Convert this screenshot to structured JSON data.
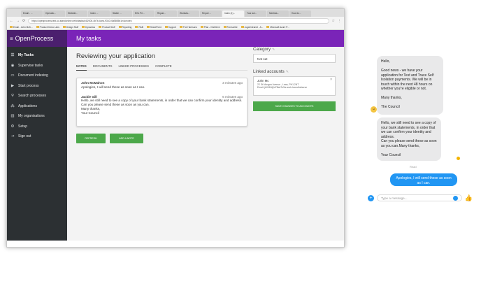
{
  "browser": {
    "tabs": [
      "Email - ...",
      "Operatio...",
      "Website...",
      "Index ...",
      "Stable ...",
      "EGL Pri...",
      "Repair...",
      "Worksta...",
      "Report ...",
      "Index (1)...",
      "Your act...",
      "Meetsta...",
      "How do..."
    ],
    "url": "https://openprocess.test.uo.standonline.net/#/tasks/d4f2000-4b7b-4cea-9310-f4a5805b1e4c/notes",
    "bookmarks": [
      "Email - John McK...",
      "Product Demo Labs",
      "Design Stuff",
      "Dynamics",
      "Product Stuff",
      "Reporting",
      "RAB",
      "SharePoint",
      "Support",
      "The Harrisons",
      "Plan - OneDrive",
      "Forescribe",
      "Jugal Intranet - A...",
      "Microsoft Azure P..."
    ]
  },
  "app": {
    "brand": "OpenProcess",
    "header_title": "My tasks"
  },
  "sidebar": {
    "items": [
      {
        "label": "My Tasks",
        "icon": "list-icon"
      },
      {
        "label": "Supervise tasks",
        "icon": "supervise-icon"
      },
      {
        "label": "Document indexing",
        "icon": "document-icon"
      },
      {
        "label": "Start process",
        "icon": "play-icon"
      },
      {
        "label": "Search processes",
        "icon": "search-icon"
      },
      {
        "label": "Applications",
        "icon": "applications-icon"
      },
      {
        "label": "My organisations",
        "icon": "organisation-icon"
      },
      {
        "label": "Setup",
        "icon": "gear-icon"
      },
      {
        "label": "Sign out",
        "icon": "sign-out-icon"
      }
    ]
  },
  "main": {
    "title": "Reviewing your application",
    "tabs": [
      "NOTES",
      "DOCUMENTS",
      "LINKED PROCESSES",
      "COMPLETE"
    ],
    "notes": [
      {
        "author": "John McMahon",
        "time": "3 minutes ago",
        "text": "Apologies, I will send these as soon as I can."
      },
      {
        "author": "Jackie Gill",
        "time": "6 minutes ago",
        "text": "Hello, we still need to see a copy of your bank statements, in order that we can confirm your identity and address.\nCan you please send these as soon as you can.\nMany thanks,\nYour Council"
      }
    ],
    "refresh_label": "REFRESH",
    "add_note_label": "ADD A NOTE"
  },
  "right": {
    "category_label": "Category",
    "category_value": "Not set",
    "linked_label": "Linked accounts",
    "account_name": "John Mc",
    "account_address": "22 St Mungos Avenue , Lean, PH1 2NT",
    "account_email": "Email: jb0018@d78a47e9a.work.locustheburse",
    "save_label": "SAVE CHANGES TO ACCOUNTS"
  },
  "chat": {
    "msg1": "Hello,\n\nGood news - we have your application for Test and Trace Self Isolation payments. We will be in touch within the next 48 hours on whether you're eligible or not.\n\nMany thanks,\n\nThe Council",
    "msg2": "Hello, we still need to see a copy of your bank statements, in order that we can confirm your identity and address.\nCan you please send these as soon as you can.Many thanks,\n\nYour Council",
    "read_label": "Read",
    "reply": "Apologies, I will send these as soon as I can.",
    "placeholder": "Type a message..."
  }
}
